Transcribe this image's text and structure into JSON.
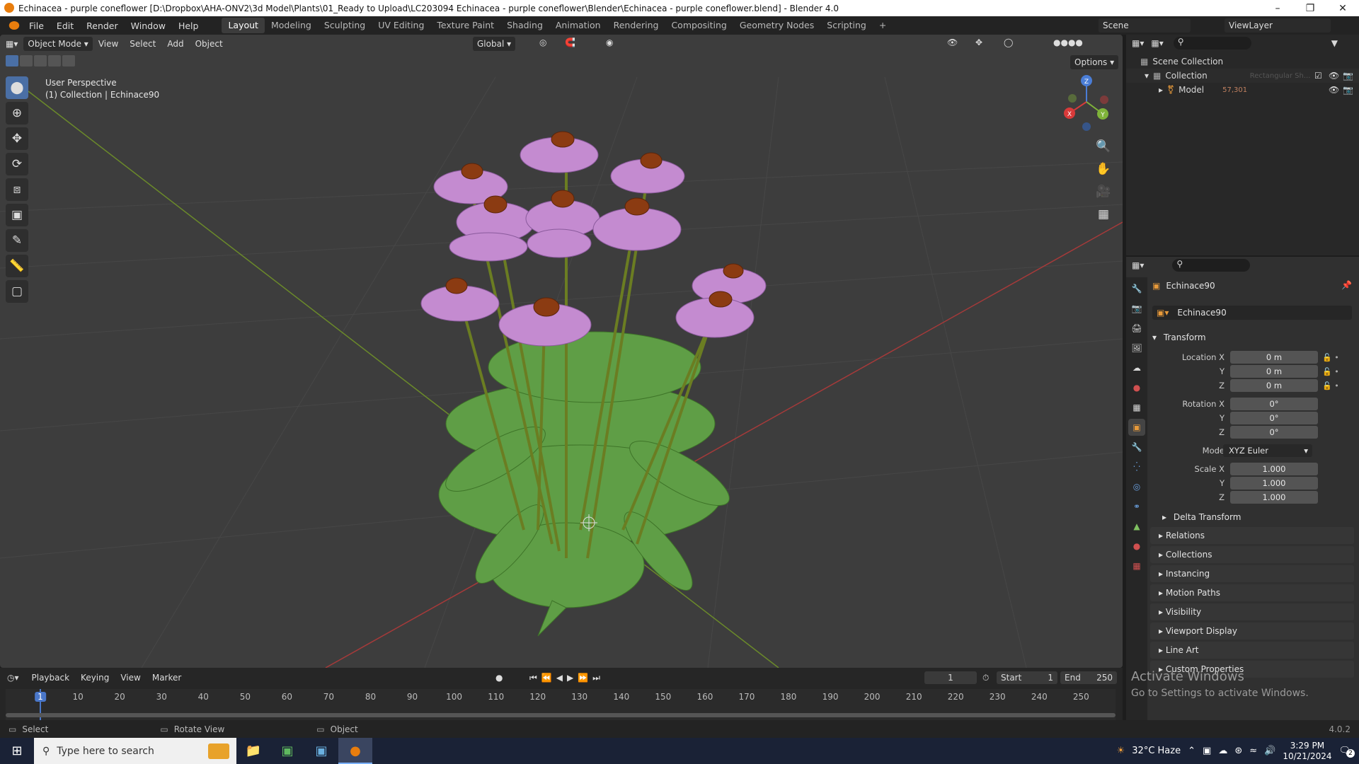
{
  "window": {
    "title": "Echinacea - purple coneflower [D:\\Dropbox\\AHA-ONV2\\3d Model\\Plants\\01_Ready to Upload\\LC203094 Echinacea - purple coneflower\\Blender\\Echinacea - purple coneflower.blend] - Blender 4.0"
  },
  "menus": [
    "File",
    "Edit",
    "Render",
    "Window",
    "Help"
  ],
  "workspaces": [
    "Layout",
    "Modeling",
    "Sculpting",
    "UV Editing",
    "Texture Paint",
    "Shading",
    "Animation",
    "Rendering",
    "Compositing",
    "Geometry Nodes",
    "Scripting",
    "+"
  ],
  "scene": {
    "name": "Scene",
    "view_layer": "ViewLayer"
  },
  "viewport": {
    "mode": "Object Mode",
    "menus": [
      "View",
      "Select",
      "Add",
      "Object"
    ],
    "orientation": "Global",
    "options": "Options",
    "overlay_line1": "User Perspective",
    "overlay_line2": "(1) Collection | Echinace90",
    "gizmo_axes": [
      "X",
      "Y",
      "Z"
    ]
  },
  "outliner": {
    "root": "Scene Collection",
    "items": [
      {
        "label": "Collection"
      },
      {
        "label": "Model"
      }
    ],
    "model_count": "57,301",
    "ghost_text": "Rectangular Sh..."
  },
  "properties": {
    "object_name": "Echinace90",
    "datablock": "Echinace90",
    "transform_header": "Transform",
    "location": {
      "label": "Location X",
      "x": "0 m",
      "y": "0 m",
      "z": "0 m"
    },
    "rotation": {
      "label": "Rotation X",
      "x": "0°",
      "y": "0°",
      "z": "0°"
    },
    "mode_label": "Mode",
    "mode_value": "XYZ Euler",
    "scale": {
      "label": "Scale X",
      "x": "1.000",
      "y": "1.000",
      "z": "1.000"
    },
    "axis_y": "Y",
    "axis_z": "Z",
    "delta": "Delta Transform",
    "sections": [
      "Relations",
      "Collections",
      "Instancing",
      "Motion Paths",
      "Visibility",
      "Viewport Display",
      "Line Art",
      "Custom Properties"
    ]
  },
  "timeline": {
    "menus": [
      "Playback",
      "Keying",
      "View",
      "Marker"
    ],
    "current_frame": "1",
    "start_label": "Start",
    "start": "1",
    "end_label": "End",
    "end": "250",
    "ticks": [
      "1",
      "10",
      "20",
      "30",
      "40",
      "50",
      "60",
      "70",
      "80",
      "90",
      "100",
      "110",
      "120",
      "130",
      "140",
      "150",
      "160",
      "170",
      "180",
      "190",
      "200",
      "210",
      "220",
      "230",
      "240",
      "250"
    ]
  },
  "watermark": {
    "line1": "Activate Windows",
    "line2": "Go to Settings to activate Windows."
  },
  "status": {
    "select": "Select",
    "rotate": "Rotate View",
    "object": "Object",
    "version": "4.0.2"
  },
  "taskbar": {
    "search_placeholder": "Type here to search",
    "weather": "32°C  Haze",
    "time": "3:29 PM",
    "date": "10/21/2024",
    "notif_count": "2"
  }
}
